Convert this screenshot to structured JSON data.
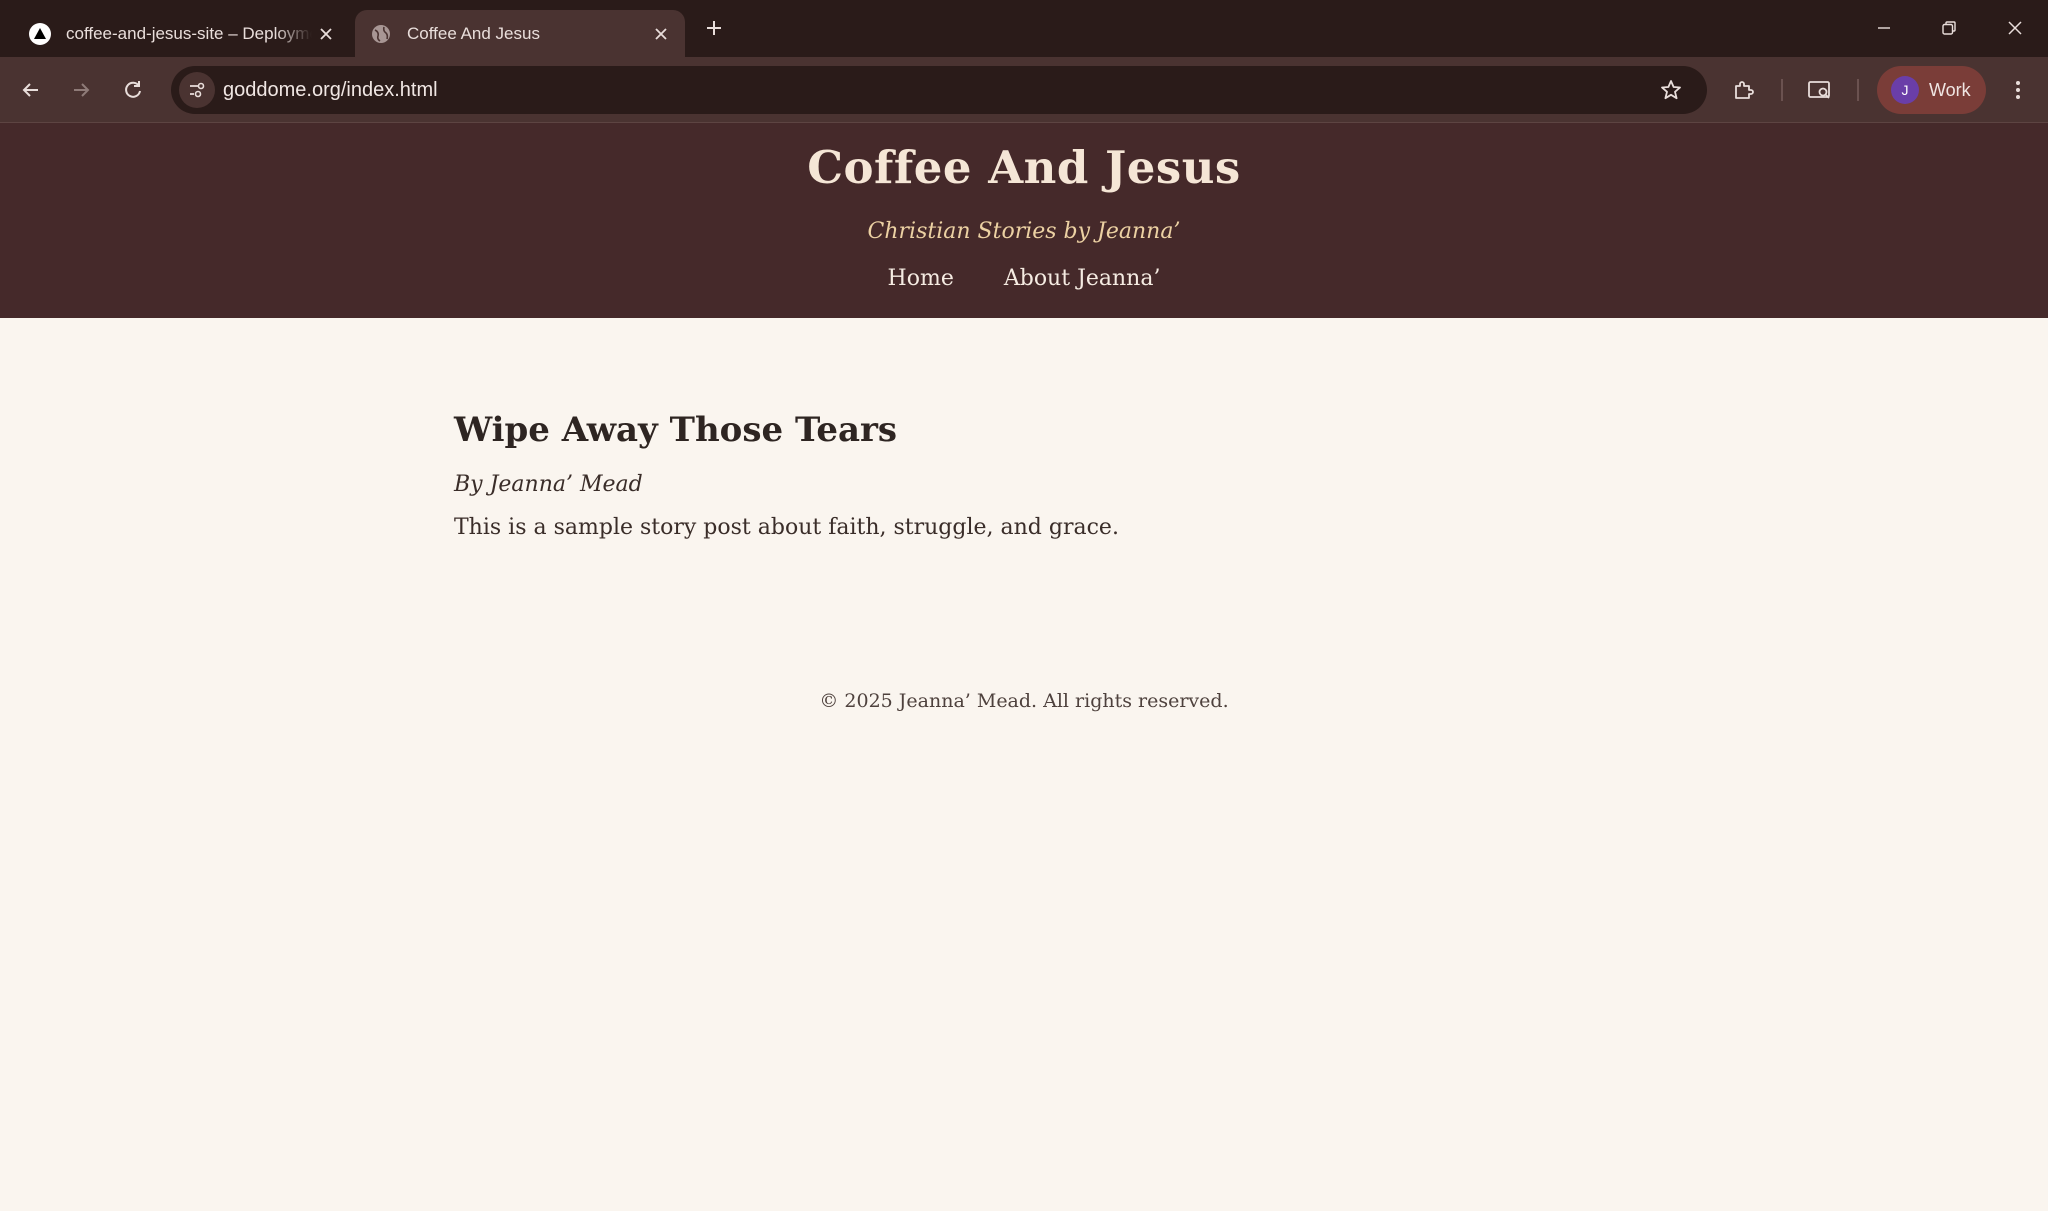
{
  "browser": {
    "tabs": [
      {
        "title": "coffee-and-jesus-site – Deployment",
        "active": false,
        "favicon": "vercel-triangle-icon"
      },
      {
        "title": "Coffee And Jesus",
        "active": true,
        "favicon": "globe-icon"
      }
    ],
    "url": "goddome.org/index.html",
    "profile": {
      "initial": "J",
      "label": "Work"
    }
  },
  "site": {
    "title": "Coffee And Jesus",
    "tagline": "Christian Stories by Jeanna’",
    "nav": [
      {
        "label": "Home"
      },
      {
        "label": "About Jeanna’"
      }
    ]
  },
  "post": {
    "title": "Wipe Away Those Tears",
    "byline": "By Jeanna’ Mead",
    "body": "This is a sample story post about faith, struggle, and grace."
  },
  "footer": {
    "text": "© 2025 Jeanna’ Mead. All rights reserved."
  },
  "colors": {
    "header_bg": "#45292a",
    "page_bg": "#faf5ef",
    "tagline": "#ecd1a3",
    "chrome_bg": "#2a1b19"
  }
}
